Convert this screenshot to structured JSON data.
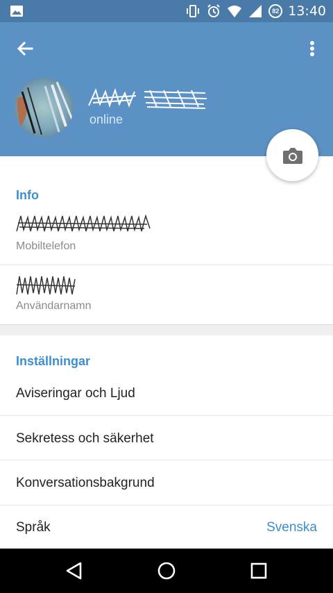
{
  "statusbar": {
    "time": "13:40",
    "battery_level": "82"
  },
  "header": {
    "status": "online"
  },
  "info": {
    "title": "Info",
    "phone_label": "Mobiltelefon",
    "username_label": "Användarnamn"
  },
  "settings": {
    "title": "Inställningar",
    "items": [
      {
        "label": "Aviseringar och Ljud"
      },
      {
        "label": "Sekretess och säkerhet"
      },
      {
        "label": "Konversationsbakgrund"
      },
      {
        "label": "Språk",
        "value": "Svenska"
      }
    ]
  },
  "colors": {
    "header": "#5b91c4",
    "statusbar": "#4a7aa8",
    "accent": "#3b8ed0"
  }
}
